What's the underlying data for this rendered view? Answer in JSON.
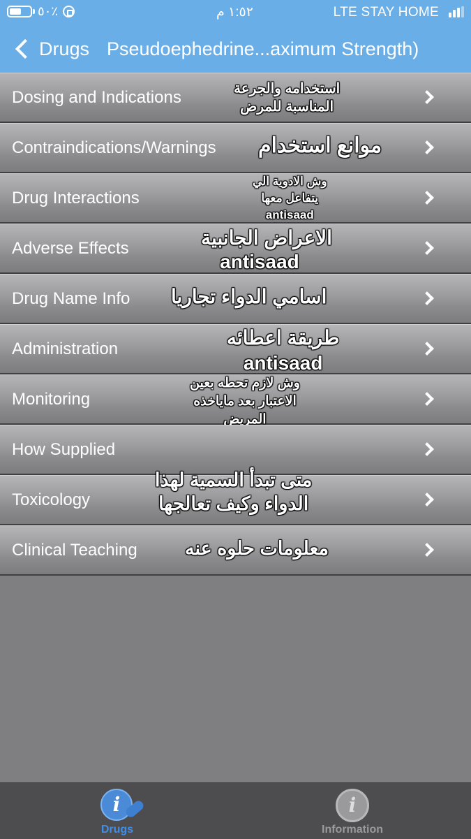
{
  "status_bar": {
    "battery_percent": "٥٠٪",
    "time": "١:٥٢ م",
    "carrier": "LTE  STAY HOME"
  },
  "nav": {
    "back_label": "Drugs",
    "title": "Pseudoephedrine...aximum Strength)"
  },
  "menu": [
    {
      "label": "Dosing and Indications",
      "note": [
        "استخدامه والجرعة",
        "المناسبة للمرض"
      ]
    },
    {
      "label": "Contraindications/Warnings",
      "note": [
        "موانع استخدام"
      ]
    },
    {
      "label": "Drug Interactions",
      "note": [
        "وش الادوية الي",
        "يتفاعل معها",
        "antisaad"
      ]
    },
    {
      "label": "Adverse Effects",
      "note": [
        "الاعراض الجانبية",
        "antisaad"
      ]
    },
    {
      "label": "Drug Name Info",
      "note": [
        "اسامي الدواء تجاريا"
      ]
    },
    {
      "label": "Administration",
      "note": [
        "طريقة اعطائه",
        "antisaad"
      ]
    },
    {
      "label": "Monitoring",
      "note": [
        "وش لازم تحطه بعين",
        "الاعتبار بعد ماياخذه",
        "المريض"
      ]
    },
    {
      "label": "How Supplied",
      "note": []
    },
    {
      "label": "Toxicology",
      "note": [
        "متى تبدأ السمية لهذا",
        "الدواء وكيف تعالجها"
      ]
    },
    {
      "label": "Clinical Teaching",
      "note": [
        "معلومات حلوه عنه"
      ]
    }
  ],
  "tabs": [
    {
      "label": "Drugs",
      "icon": "drugs-info-icon",
      "selected": true
    },
    {
      "label": "Information",
      "icon": "info-icon",
      "selected": false
    }
  ],
  "colors": {
    "header": "#6aaee8",
    "active_tab": "#3f8ee8"
  }
}
